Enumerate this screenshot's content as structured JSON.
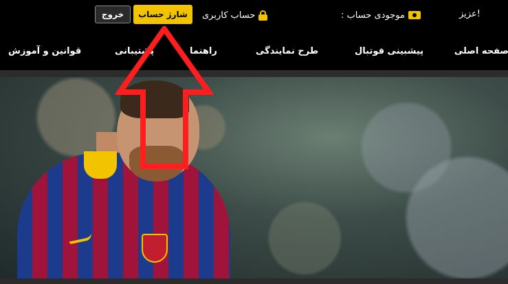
{
  "topbar": {
    "logout_label": "خروج",
    "charge_label": "شارژ حساب",
    "user_account_label": "حساب کاربری",
    "user_account_icon": "lock-icon",
    "balance_label": "موجودی حساب :",
    "balance_icon": "money-icon",
    "greeting": "عزیز!",
    "accent_color": "#f2c400"
  },
  "nav": {
    "items": [
      {
        "label": "صفحه اصلی"
      },
      {
        "label": "پیشبینی فوتبال"
      },
      {
        "label": "طرح نمایندگی"
      },
      {
        "label": "راهنما"
      },
      {
        "label": "پشتیبانی"
      },
      {
        "label": "قوانین و آموزش"
      }
    ]
  },
  "hero": {
    "image_description": "football-player-photo"
  },
  "annotation": {
    "arrow_color": "#ff1e1e"
  }
}
